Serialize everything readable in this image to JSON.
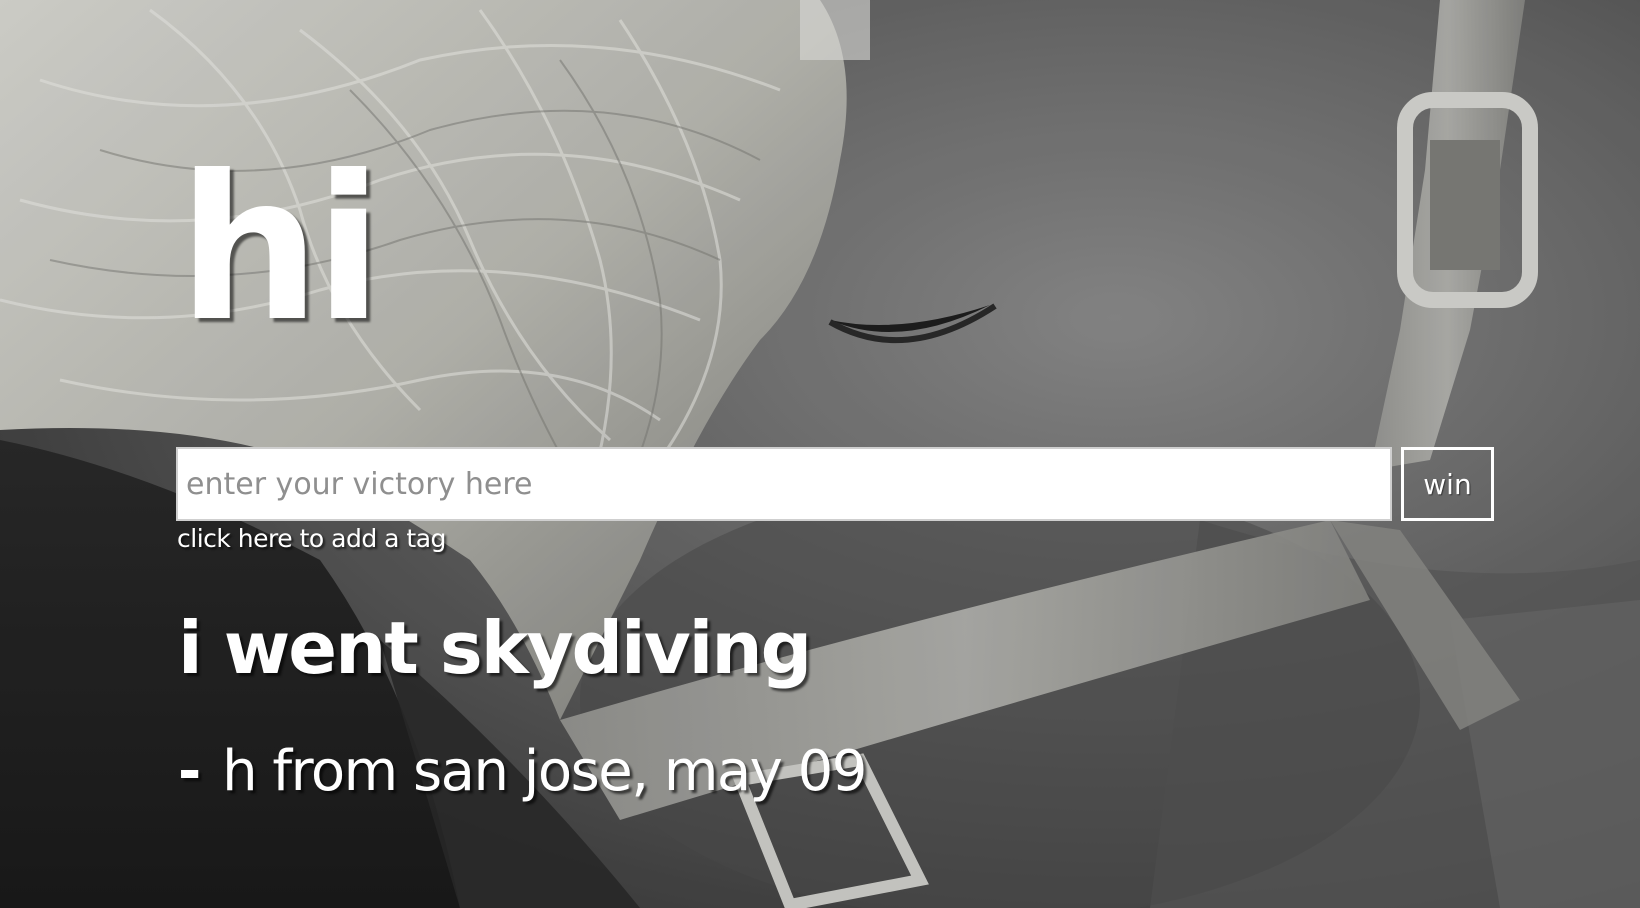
{
  "page": {
    "title": "hi"
  },
  "form": {
    "input_placeholder": "enter your victory here",
    "input_value": "",
    "submit_label": "win",
    "tag_link_label": "click here to add a tag"
  },
  "featured_victory": {
    "text": "i went skydiving",
    "dash": "-",
    "attribution": "h from san jose, may 09"
  },
  "background": {
    "description_icon": "photo-background",
    "tone": "black-and-white"
  },
  "colors": {
    "text": "#ffffff",
    "input_background": "#ffffff",
    "placeholder": "#8f8f8f",
    "button_border": "#ffffff"
  }
}
